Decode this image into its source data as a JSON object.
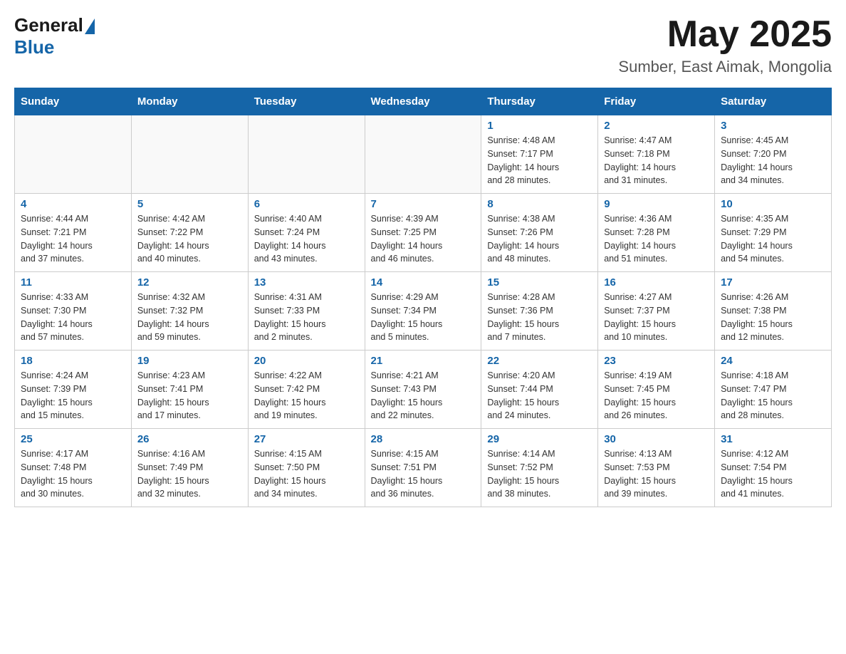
{
  "header": {
    "logo_general": "General",
    "logo_blue": "Blue",
    "month_year": "May 2025",
    "location": "Sumber, East Aimak, Mongolia"
  },
  "weekdays": [
    "Sunday",
    "Monday",
    "Tuesday",
    "Wednesday",
    "Thursday",
    "Friday",
    "Saturday"
  ],
  "weeks": [
    [
      {
        "day": "",
        "info": ""
      },
      {
        "day": "",
        "info": ""
      },
      {
        "day": "",
        "info": ""
      },
      {
        "day": "",
        "info": ""
      },
      {
        "day": "1",
        "info": "Sunrise: 4:48 AM\nSunset: 7:17 PM\nDaylight: 14 hours\nand 28 minutes."
      },
      {
        "day": "2",
        "info": "Sunrise: 4:47 AM\nSunset: 7:18 PM\nDaylight: 14 hours\nand 31 minutes."
      },
      {
        "day": "3",
        "info": "Sunrise: 4:45 AM\nSunset: 7:20 PM\nDaylight: 14 hours\nand 34 minutes."
      }
    ],
    [
      {
        "day": "4",
        "info": "Sunrise: 4:44 AM\nSunset: 7:21 PM\nDaylight: 14 hours\nand 37 minutes."
      },
      {
        "day": "5",
        "info": "Sunrise: 4:42 AM\nSunset: 7:22 PM\nDaylight: 14 hours\nand 40 minutes."
      },
      {
        "day": "6",
        "info": "Sunrise: 4:40 AM\nSunset: 7:24 PM\nDaylight: 14 hours\nand 43 minutes."
      },
      {
        "day": "7",
        "info": "Sunrise: 4:39 AM\nSunset: 7:25 PM\nDaylight: 14 hours\nand 46 minutes."
      },
      {
        "day": "8",
        "info": "Sunrise: 4:38 AM\nSunset: 7:26 PM\nDaylight: 14 hours\nand 48 minutes."
      },
      {
        "day": "9",
        "info": "Sunrise: 4:36 AM\nSunset: 7:28 PM\nDaylight: 14 hours\nand 51 minutes."
      },
      {
        "day": "10",
        "info": "Sunrise: 4:35 AM\nSunset: 7:29 PM\nDaylight: 14 hours\nand 54 minutes."
      }
    ],
    [
      {
        "day": "11",
        "info": "Sunrise: 4:33 AM\nSunset: 7:30 PM\nDaylight: 14 hours\nand 57 minutes."
      },
      {
        "day": "12",
        "info": "Sunrise: 4:32 AM\nSunset: 7:32 PM\nDaylight: 14 hours\nand 59 minutes."
      },
      {
        "day": "13",
        "info": "Sunrise: 4:31 AM\nSunset: 7:33 PM\nDaylight: 15 hours\nand 2 minutes."
      },
      {
        "day": "14",
        "info": "Sunrise: 4:29 AM\nSunset: 7:34 PM\nDaylight: 15 hours\nand 5 minutes."
      },
      {
        "day": "15",
        "info": "Sunrise: 4:28 AM\nSunset: 7:36 PM\nDaylight: 15 hours\nand 7 minutes."
      },
      {
        "day": "16",
        "info": "Sunrise: 4:27 AM\nSunset: 7:37 PM\nDaylight: 15 hours\nand 10 minutes."
      },
      {
        "day": "17",
        "info": "Sunrise: 4:26 AM\nSunset: 7:38 PM\nDaylight: 15 hours\nand 12 minutes."
      }
    ],
    [
      {
        "day": "18",
        "info": "Sunrise: 4:24 AM\nSunset: 7:39 PM\nDaylight: 15 hours\nand 15 minutes."
      },
      {
        "day": "19",
        "info": "Sunrise: 4:23 AM\nSunset: 7:41 PM\nDaylight: 15 hours\nand 17 minutes."
      },
      {
        "day": "20",
        "info": "Sunrise: 4:22 AM\nSunset: 7:42 PM\nDaylight: 15 hours\nand 19 minutes."
      },
      {
        "day": "21",
        "info": "Sunrise: 4:21 AM\nSunset: 7:43 PM\nDaylight: 15 hours\nand 22 minutes."
      },
      {
        "day": "22",
        "info": "Sunrise: 4:20 AM\nSunset: 7:44 PM\nDaylight: 15 hours\nand 24 minutes."
      },
      {
        "day": "23",
        "info": "Sunrise: 4:19 AM\nSunset: 7:45 PM\nDaylight: 15 hours\nand 26 minutes."
      },
      {
        "day": "24",
        "info": "Sunrise: 4:18 AM\nSunset: 7:47 PM\nDaylight: 15 hours\nand 28 minutes."
      }
    ],
    [
      {
        "day": "25",
        "info": "Sunrise: 4:17 AM\nSunset: 7:48 PM\nDaylight: 15 hours\nand 30 minutes."
      },
      {
        "day": "26",
        "info": "Sunrise: 4:16 AM\nSunset: 7:49 PM\nDaylight: 15 hours\nand 32 minutes."
      },
      {
        "day": "27",
        "info": "Sunrise: 4:15 AM\nSunset: 7:50 PM\nDaylight: 15 hours\nand 34 minutes."
      },
      {
        "day": "28",
        "info": "Sunrise: 4:15 AM\nSunset: 7:51 PM\nDaylight: 15 hours\nand 36 minutes."
      },
      {
        "day": "29",
        "info": "Sunrise: 4:14 AM\nSunset: 7:52 PM\nDaylight: 15 hours\nand 38 minutes."
      },
      {
        "day": "30",
        "info": "Sunrise: 4:13 AM\nSunset: 7:53 PM\nDaylight: 15 hours\nand 39 minutes."
      },
      {
        "day": "31",
        "info": "Sunrise: 4:12 AM\nSunset: 7:54 PM\nDaylight: 15 hours\nand 41 minutes."
      }
    ]
  ]
}
